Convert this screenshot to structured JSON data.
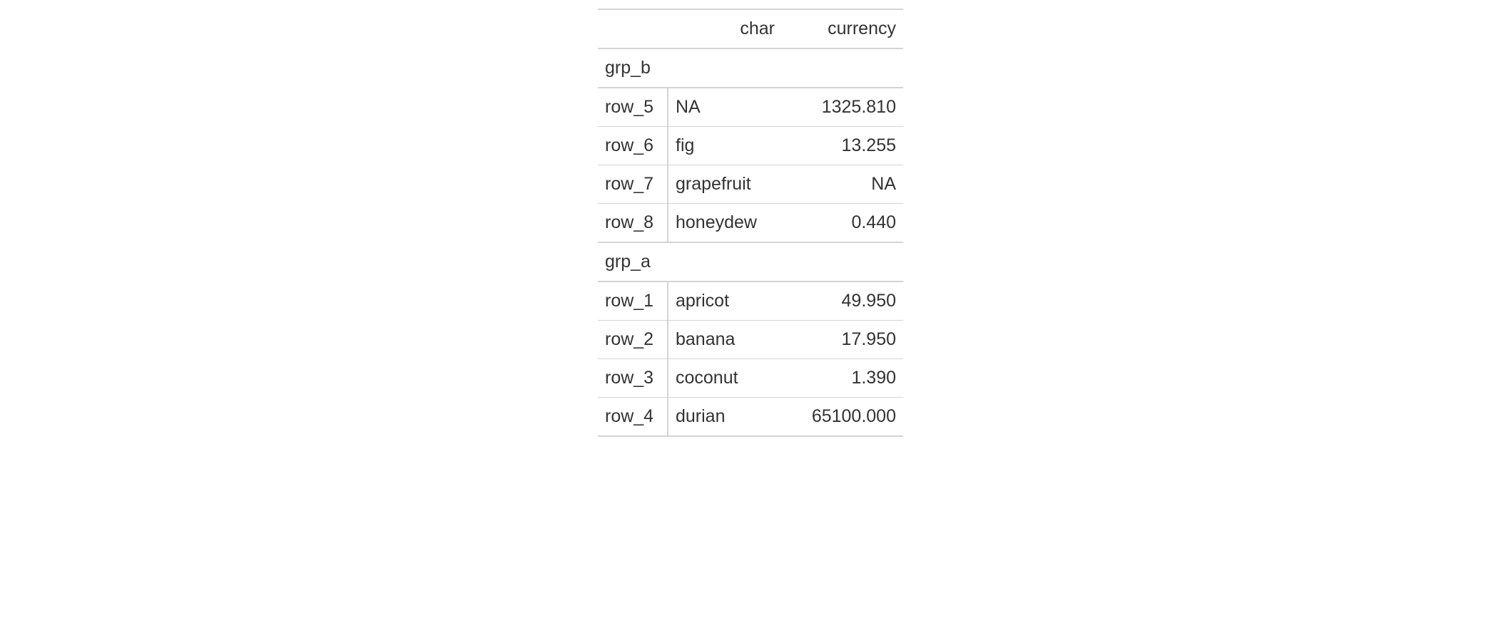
{
  "table": {
    "columns": {
      "stub": "",
      "char": "char",
      "currency": "currency"
    },
    "groups": [
      {
        "label": "grp_b",
        "rows": [
          {
            "stub": "row_5",
            "char": "NA",
            "currency": "1325.810"
          },
          {
            "stub": "row_6",
            "char": "fig",
            "currency": "13.255"
          },
          {
            "stub": "row_7",
            "char": "grapefruit",
            "currency": "NA"
          },
          {
            "stub": "row_8",
            "char": "honeydew",
            "currency": "0.440"
          }
        ]
      },
      {
        "label": "grp_a",
        "rows": [
          {
            "stub": "row_1",
            "char": "apricot",
            "currency": "49.950"
          },
          {
            "stub": "row_2",
            "char": "banana",
            "currency": "17.950"
          },
          {
            "stub": "row_3",
            "char": "coconut",
            "currency": "1.390"
          },
          {
            "stub": "row_4",
            "char": "durian",
            "currency": "65100.000"
          }
        ]
      }
    ]
  }
}
